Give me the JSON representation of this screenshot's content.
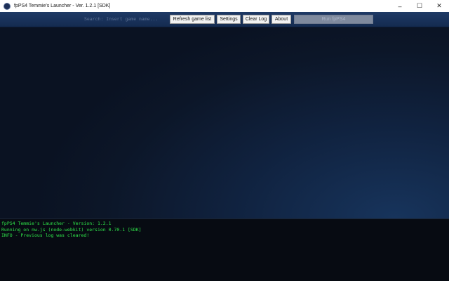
{
  "window": {
    "title": "fpPS4 Temmie's Launcher - Ver. 1.2.1 [SDK]",
    "controls": {
      "minimize": "–",
      "maximize": "☐",
      "close": "✕"
    }
  },
  "toolbar": {
    "search_placeholder": "Search: Insert game name...",
    "refresh_label": "Refresh game list",
    "settings_label": "Settings",
    "clear_log_label": "Clear Log",
    "about_label": "About",
    "run_label": "Run fpPS4"
  },
  "log": {
    "lines": [
      "fpPS4 Temmie's Launcher - Version: 1.2.1",
      "Running on nw.js (node-webkit) version 0.70.1 [SDK]",
      "INFO - Previous log was cleared!"
    ]
  },
  "colors": {
    "toolbar_bg": "#1f3a66",
    "log_text": "#2fe64a",
    "main_bg": "#0c1628"
  }
}
